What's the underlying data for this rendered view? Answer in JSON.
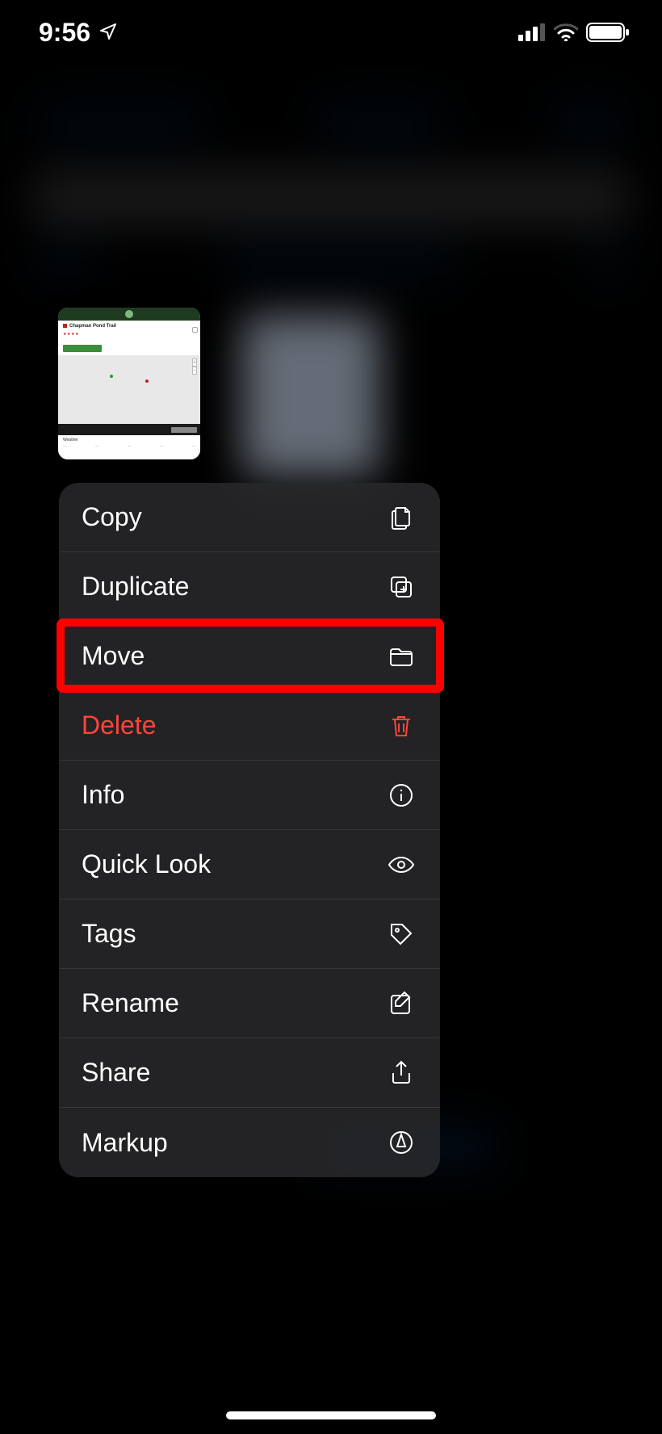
{
  "status": {
    "time": "9:56",
    "location_icon": "location"
  },
  "thumbnail": {
    "title": "Chapman Pond Trail",
    "stars": "★★★★",
    "button": "",
    "footer_label": "Weather"
  },
  "menu": {
    "items": [
      {
        "label": "Copy",
        "icon": "copy",
        "destructive": false
      },
      {
        "label": "Duplicate",
        "icon": "duplicate",
        "destructive": false
      },
      {
        "label": "Move",
        "icon": "folder",
        "destructive": false
      },
      {
        "label": "Delete",
        "icon": "trash",
        "destructive": true
      },
      {
        "label": "Info",
        "icon": "info",
        "destructive": false
      },
      {
        "label": "Quick Look",
        "icon": "eye",
        "destructive": false
      },
      {
        "label": "Tags",
        "icon": "tag",
        "destructive": false
      },
      {
        "label": "Rename",
        "icon": "rename",
        "destructive": false
      },
      {
        "label": "Share",
        "icon": "share",
        "destructive": false
      },
      {
        "label": "Markup",
        "icon": "markup",
        "destructive": false
      }
    ]
  },
  "annotation": {
    "highlighted_item_index": 2
  }
}
